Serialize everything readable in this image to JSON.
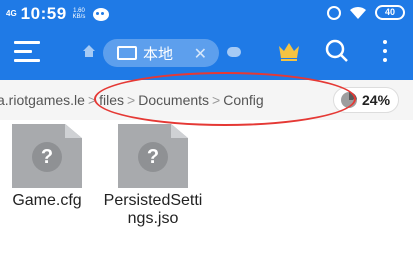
{
  "status": {
    "network": "4G",
    "time": "10:59",
    "rate_value": "1.60",
    "rate_unit": "KB/s",
    "battery": "40",
    "icons": [
      "signal-icon",
      "chat-icon",
      "alarm-icon",
      "wifi-icon",
      "battery-icon"
    ]
  },
  "toolbar": {
    "tab_label": "本地",
    "tab_close": "✕"
  },
  "path": {
    "crumbs": [
      "a.riotgames.le",
      "files",
      "Documents",
      "Config"
    ],
    "separator": ">",
    "storage_percent": "24%"
  },
  "files": [
    {
      "name": "Game.cfg",
      "icon": "unknown-file-icon"
    },
    {
      "name": "PersistedSettings.jso",
      "icon": "unknown-file-icon"
    }
  ],
  "colors": {
    "accent": "#1f7ae6",
    "annotation": "#e53935"
  }
}
